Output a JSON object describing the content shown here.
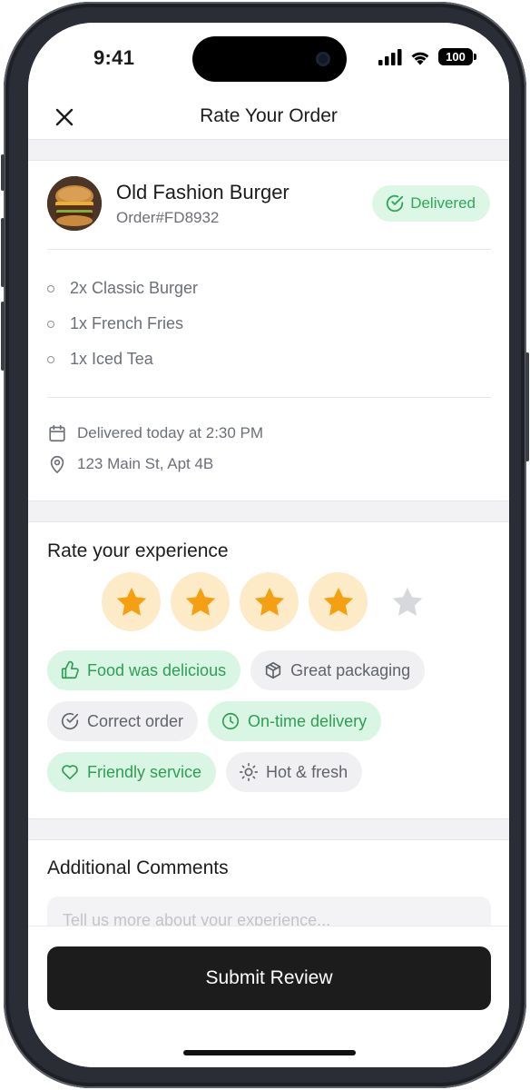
{
  "status_bar": {
    "time": "9:41",
    "battery": "100"
  },
  "header": {
    "title": "Rate Your Order",
    "close_icon": "close-icon"
  },
  "order": {
    "restaurant": "Old Fashion Burger",
    "order_id": "Order#FD8932",
    "status": "Delivered",
    "status_color": "#2fa85a",
    "items": [
      "2x Classic Burger",
      "1x French Fries",
      "1x Iced Tea"
    ],
    "delivered_time": "Delivered today at 2:30 PM",
    "address": "123 Main St, Apt 4B"
  },
  "rating": {
    "title": "Rate your experience",
    "value": 4,
    "max": 5,
    "star_color": "#f5a012",
    "tags": [
      {
        "label": "Food was delicious",
        "icon": "thumbs-up-icon",
        "selected": true
      },
      {
        "label": "Great packaging",
        "icon": "package-icon",
        "selected": false
      },
      {
        "label": "Correct order",
        "icon": "check-circle-icon",
        "selected": false
      },
      {
        "label": "On-time delivery",
        "icon": "clock-icon",
        "selected": true
      },
      {
        "label": "Friendly service",
        "icon": "heart-icon",
        "selected": true
      },
      {
        "label": "Hot & fresh",
        "icon": "sun-icon",
        "selected": false
      }
    ]
  },
  "comments": {
    "title": "Additional Comments",
    "placeholder": "Tell us more about your experience...",
    "value": ""
  },
  "submit_label": "Submit Review"
}
